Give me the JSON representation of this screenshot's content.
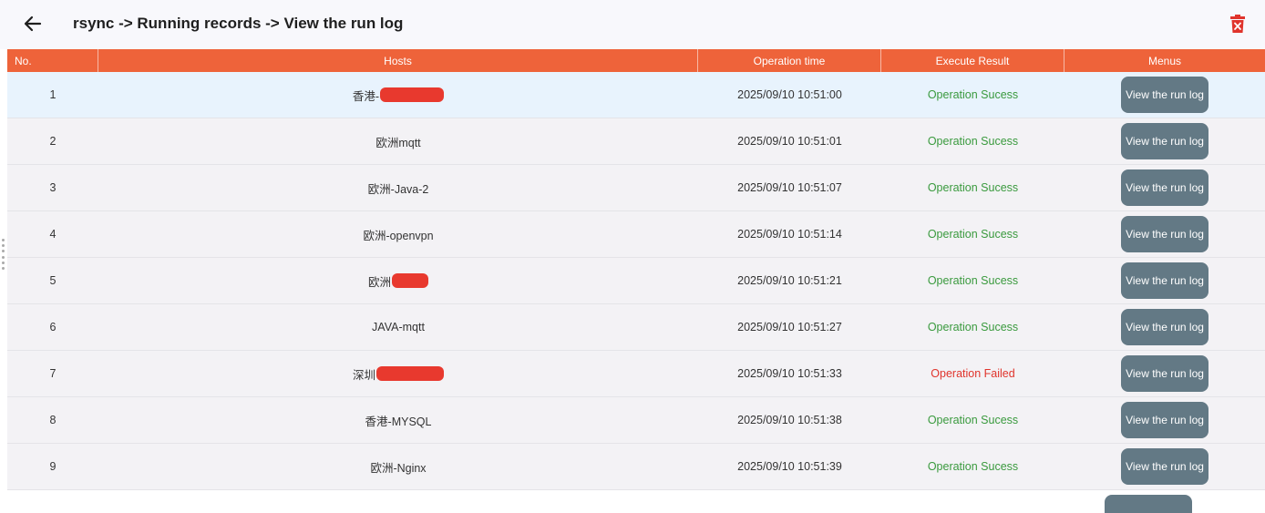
{
  "header": {
    "title": "rsync -> Running records -> View the run log",
    "back_icon": "arrow-left-icon",
    "delete_icon": "trash-delete-icon"
  },
  "colors": {
    "header_row": "#ee633a",
    "button": "#637985",
    "success": "#3a9a3e",
    "failed": "#e0342c",
    "selected_row": "#e8f3fd",
    "row": "#f3f2f5",
    "redaction": "#e8392e"
  },
  "table": {
    "columns": [
      "No.",
      "Hosts",
      "Operation time",
      "Execute Result",
      "Menus"
    ],
    "rows": [
      {
        "no": "1",
        "host": "香港-",
        "host_redacted": true,
        "time": "2025/09/10 10:51:00",
        "result": "Operation Sucess",
        "status": "ok",
        "button": "View the run log"
      },
      {
        "no": "2",
        "host": "欧洲mqtt",
        "host_redacted": false,
        "time": "2025/09/10 10:51:01",
        "result": "Operation Sucess",
        "status": "ok",
        "button": "View the run log"
      },
      {
        "no": "3",
        "host": "欧洲-Java-2",
        "host_redacted": false,
        "time": "2025/09/10 10:51:07",
        "result": "Operation Sucess",
        "status": "ok",
        "button": "View the run log"
      },
      {
        "no": "4",
        "host": "欧洲-openvpn",
        "host_redacted": false,
        "time": "2025/09/10 10:51:14",
        "result": "Operation Sucess",
        "status": "ok",
        "button": "View the run log"
      },
      {
        "no": "5",
        "host": "欧洲",
        "host_redacted": true,
        "time": "2025/09/10 10:51:21",
        "result": "Operation Sucess",
        "status": "ok",
        "button": "View the run log"
      },
      {
        "no": "6",
        "host": "JAVA-mqtt",
        "host_redacted": false,
        "time": "2025/09/10 10:51:27",
        "result": "Operation Sucess",
        "status": "ok",
        "button": "View the run log"
      },
      {
        "no": "7",
        "host": "深圳",
        "host_redacted": true,
        "time": "2025/09/10 10:51:33",
        "result": "Operation Failed",
        "status": "fail",
        "button": "View the run log"
      },
      {
        "no": "8",
        "host": "香港-MYSQL",
        "host_redacted": false,
        "time": "2025/09/10 10:51:38",
        "result": "Operation Sucess",
        "status": "ok",
        "button": "View the run log"
      },
      {
        "no": "9",
        "host": "欧洲-Nginx",
        "host_redacted": false,
        "time": "2025/09/10 10:51:39",
        "result": "Operation Sucess",
        "status": "ok",
        "button": "View the run log"
      }
    ]
  }
}
